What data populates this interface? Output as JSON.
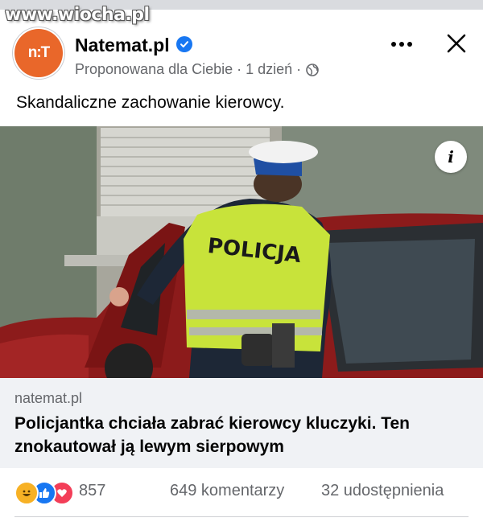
{
  "watermark": "www.wiocha.pl",
  "post": {
    "page_name": "Natemat.pl",
    "avatar_text": "n:T",
    "meta": "Proponowana dla Ciebie · 1 dzień ·",
    "caption": "Skandaliczne zachowanie kierowcy.",
    "more_icon": "more-horizontal-icon",
    "close_icon": "close-icon"
  },
  "photo": {
    "vest_text": "POLICJA",
    "info_label": "i"
  },
  "link_preview": {
    "domain": "natemat.pl",
    "headline": "Policjantka chciała zabrać kierowcy kluczyki. Ten znokautował ją lewym sierpowym"
  },
  "engagement": {
    "reaction_count": "857",
    "comments": "649 komentarzy",
    "shares": "32 udostępnienia",
    "reactions": [
      "haha",
      "like",
      "love"
    ]
  },
  "colors": {
    "brand_avatar": "#e9672a",
    "verified": "#1877f2",
    "secondary_text": "#65676b",
    "preview_bg": "#f0f2f5"
  }
}
